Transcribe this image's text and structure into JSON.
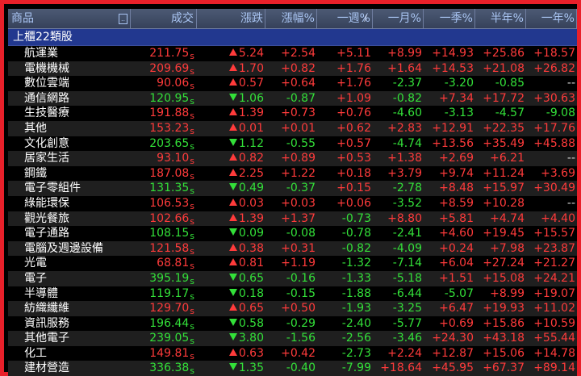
{
  "colors": {
    "up": "#ff3b3b",
    "down": "#33e039",
    "frame": "#e8202a",
    "group": "#22388f"
  },
  "header": {
    "product": "商品",
    "sort_icon": "..",
    "price": "成交",
    "change": "漲跌",
    "pct": "漲幅%",
    "week": "一週%",
    "week_marker": "/",
    "month": "一月%",
    "quarter": "一季%",
    "half": "半年%",
    "year": "一年%"
  },
  "group": {
    "label": "上櫃22類股"
  },
  "rows": [
    {
      "name": "航運業",
      "price": "211.75",
      "suffix": "s",
      "dir": "up",
      "chg": "5.24",
      "pct": "+2.54",
      "week": "+5.11",
      "month": "+8.99",
      "quarter": "+14.93",
      "half": "+25.86",
      "year": "+18.57"
    },
    {
      "name": "電機機械",
      "price": "209.69",
      "suffix": "s",
      "dir": "up",
      "chg": "1.70",
      "pct": "+0.82",
      "week": "+1.76",
      "month": "+1.64",
      "quarter": "+14.53",
      "half": "+21.08",
      "year": "+26.82"
    },
    {
      "name": "數位雲端",
      "price": "90.06",
      "suffix": "s",
      "dir": "up",
      "chg": "0.57",
      "pct": "+0.64",
      "week": "+1.76",
      "month": "-2.37",
      "quarter": "-3.20",
      "half": "-0.85",
      "year": "--"
    },
    {
      "name": "通信網路",
      "price": "120.95",
      "suffix": "s",
      "dir": "dn",
      "chg": "1.06",
      "pct": "-0.87",
      "week": "+1.09",
      "month": "-0.82",
      "quarter": "+7.34",
      "half": "+17.72",
      "year": "+30.63"
    },
    {
      "name": "生技醫療",
      "price": "191.88",
      "suffix": "s",
      "dir": "up",
      "chg": "1.39",
      "pct": "+0.73",
      "week": "+0.76",
      "month": "-4.60",
      "quarter": "-3.13",
      "half": "-4.57",
      "year": "-9.08"
    },
    {
      "name": "其他",
      "price": "153.23",
      "suffix": "s",
      "dir": "up",
      "chg": "0.01",
      "pct": "+0.01",
      "week": "+0.62",
      "month": "+2.83",
      "quarter": "+12.91",
      "half": "+22.35",
      "year": "+17.76"
    },
    {
      "name": "文化創意",
      "price": "203.65",
      "suffix": "s",
      "dir": "dn",
      "chg": "1.12",
      "pct": "-0.55",
      "week": "+0.57",
      "month": "-4.74",
      "quarter": "+13.56",
      "half": "+35.49",
      "year": "+45.88"
    },
    {
      "name": "居家生活",
      "price": "93.10",
      "suffix": "s",
      "dir": "up",
      "chg": "0.82",
      "pct": "+0.89",
      "week": "+0.53",
      "month": "+1.38",
      "quarter": "+2.69",
      "half": "+6.21",
      "year": "--"
    },
    {
      "name": "鋼鐵",
      "price": "187.08",
      "suffix": "s",
      "dir": "up",
      "chg": "2.25",
      "pct": "+1.22",
      "week": "+0.18",
      "month": "+3.79",
      "quarter": "+9.74",
      "half": "+11.24",
      "year": "+3.69"
    },
    {
      "name": "電子零組件",
      "price": "131.35",
      "suffix": "s",
      "dir": "dn",
      "chg": "0.49",
      "pct": "-0.37",
      "week": "+0.15",
      "month": "-2.78",
      "quarter": "+8.48",
      "half": "+15.97",
      "year": "+30.49"
    },
    {
      "name": "綠能環保",
      "price": "106.53",
      "suffix": "s",
      "dir": "up",
      "chg": "0.03",
      "pct": "+0.03",
      "week": "+0.06",
      "month": "-3.52",
      "quarter": "+8.59",
      "half": "+10.28",
      "year": "--"
    },
    {
      "name": "觀光餐旅",
      "price": "102.66",
      "suffix": "s",
      "dir": "up",
      "chg": "1.39",
      "pct": "+1.37",
      "week": "-0.73",
      "month": "+8.80",
      "quarter": "+5.81",
      "half": "+4.74",
      "year": "+4.40"
    },
    {
      "name": "電子通路",
      "price": "108.15",
      "suffix": "s",
      "dir": "dn",
      "chg": "0.09",
      "pct": "-0.08",
      "week": "-0.78",
      "month": "-2.41",
      "quarter": "+4.60",
      "half": "+19.45",
      "year": "+15.57"
    },
    {
      "name": "電腦及週邊設備",
      "price": "121.58",
      "suffix": "s",
      "dir": "up",
      "chg": "0.38",
      "pct": "+0.31",
      "week": "-0.82",
      "month": "-4.09",
      "quarter": "+0.24",
      "half": "+7.98",
      "year": "+23.87"
    },
    {
      "name": "光電",
      "price": "68.81",
      "suffix": "s",
      "dir": "up",
      "chg": "0.81",
      "pct": "+1.19",
      "week": "-1.32",
      "month": "-7.14",
      "quarter": "+6.04",
      "half": "+27.24",
      "year": "+21.27"
    },
    {
      "name": "電子",
      "price": "395.19",
      "suffix": "s",
      "dir": "dn",
      "chg": "0.65",
      "pct": "-0.16",
      "week": "-1.33",
      "month": "-5.18",
      "quarter": "+1.51",
      "half": "+15.08",
      "year": "+24.21"
    },
    {
      "name": "半導體",
      "price": "119.17",
      "suffix": "s",
      "dir": "dn",
      "chg": "0.18",
      "pct": "-0.15",
      "week": "-1.88",
      "month": "-6.44",
      "quarter": "-5.07",
      "half": "+8.99",
      "year": "+19.07"
    },
    {
      "name": "紡織纖維",
      "price": "129.70",
      "suffix": "s",
      "dir": "up",
      "chg": "0.65",
      "pct": "+0.50",
      "week": "-1.93",
      "month": "-3.25",
      "quarter": "+6.47",
      "half": "+19.93",
      "year": "+11.02"
    },
    {
      "name": "資訊服務",
      "price": "196.44",
      "suffix": "s",
      "dir": "dn",
      "chg": "0.58",
      "pct": "-0.29",
      "week": "-2.40",
      "month": "-5.77",
      "quarter": "+0.69",
      "half": "+15.86",
      "year": "+10.59"
    },
    {
      "name": "其他電子",
      "price": "239.05",
      "suffix": "s",
      "dir": "dn",
      "chg": "3.80",
      "pct": "-1.56",
      "week": "-2.56",
      "month": "-3.46",
      "quarter": "+24.30",
      "half": "+43.18",
      "year": "+55.44"
    },
    {
      "name": "化工",
      "price": "149.81",
      "suffix": "s",
      "dir": "up",
      "chg": "0.63",
      "pct": "+0.42",
      "week": "-2.73",
      "month": "+2.24",
      "quarter": "+12.87",
      "half": "+15.06",
      "year": "+14.78"
    },
    {
      "name": "建材營造",
      "price": "336.38",
      "suffix": "s",
      "dir": "dn",
      "chg": "1.35",
      "pct": "-0.40",
      "week": "-7.99",
      "month": "+18.64",
      "quarter": "+45.95",
      "half": "+67.37",
      "year": "+89.14"
    }
  ]
}
